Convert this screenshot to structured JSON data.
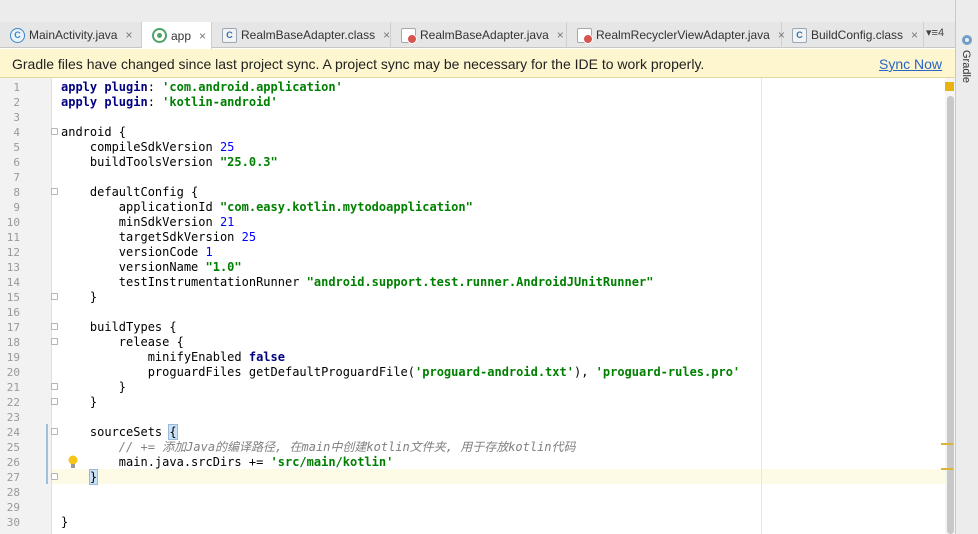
{
  "tabs": [
    {
      "label": "MainActivity.java",
      "icon": "kotlin-class-icon",
      "active": false
    },
    {
      "label": "app",
      "icon": "gradle-module-icon",
      "active": true
    },
    {
      "label": "RealmBaseAdapter.class",
      "icon": "class-file-icon",
      "active": false
    },
    {
      "label": "RealmBaseAdapter.java",
      "icon": "java-file-icon",
      "active": false
    },
    {
      "label": "RealmRecyclerViewAdapter.java",
      "icon": "java-file-icon",
      "active": false
    },
    {
      "label": "BuildConfig.class",
      "icon": "class-file-icon",
      "active": false
    }
  ],
  "tab_close_glyph": "×",
  "tab_overflow": "▾≡4",
  "side_panel": {
    "label": "Gradle"
  },
  "notification": {
    "message": "Gradle files have changed since last project sync. A project sync may be necessary for the IDE to work properly.",
    "action": "Sync Now"
  },
  "editor": {
    "line_numbers": [
      "1",
      "2",
      "3",
      "4",
      "5",
      "6",
      "7",
      "8",
      "9",
      "10",
      "11",
      "12",
      "13",
      "14",
      "15",
      "16",
      "17",
      "18",
      "19",
      "20",
      "21",
      "22",
      "23",
      "24",
      "25",
      "26",
      "27",
      "28",
      "29",
      "30"
    ],
    "lines": [
      [
        {
          "t": "apply plugin",
          "c": "kw"
        },
        {
          "t": ": ",
          "c": ""
        },
        {
          "t": "'com.android.application'",
          "c": "str"
        }
      ],
      [
        {
          "t": "apply plugin",
          "c": "kw"
        },
        {
          "t": ": ",
          "c": ""
        },
        {
          "t": "'kotlin-android'",
          "c": "str"
        }
      ],
      [],
      [
        {
          "t": "android {",
          "c": ""
        }
      ],
      [
        {
          "t": "    compileSdkVersion ",
          "c": ""
        },
        {
          "t": "25",
          "c": "num"
        }
      ],
      [
        {
          "t": "    buildToolsVersion ",
          "c": ""
        },
        {
          "t": "\"25.0.3\"",
          "c": "str"
        }
      ],
      [],
      [
        {
          "t": "    defaultConfig {",
          "c": ""
        }
      ],
      [
        {
          "t": "        applicationId ",
          "c": ""
        },
        {
          "t": "\"com.easy.kotlin.mytodoapplication\"",
          "c": "str"
        }
      ],
      [
        {
          "t": "        minSdkVersion ",
          "c": ""
        },
        {
          "t": "21",
          "c": "num"
        }
      ],
      [
        {
          "t": "        targetSdkVersion ",
          "c": ""
        },
        {
          "t": "25",
          "c": "num"
        }
      ],
      [
        {
          "t": "        versionCode ",
          "c": ""
        },
        {
          "t": "1",
          "c": "num"
        }
      ],
      [
        {
          "t": "        versionName ",
          "c": ""
        },
        {
          "t": "\"1.0\"",
          "c": "str"
        }
      ],
      [
        {
          "t": "        testInstrumentationRunner ",
          "c": ""
        },
        {
          "t": "\"android.support.test.runner.AndroidJUnitRunner\"",
          "c": "str"
        }
      ],
      [
        {
          "t": "    }",
          "c": ""
        }
      ],
      [],
      [
        {
          "t": "    buildTypes {",
          "c": ""
        }
      ],
      [
        {
          "t": "        release {",
          "c": ""
        }
      ],
      [
        {
          "t": "            minifyEnabled ",
          "c": ""
        },
        {
          "t": "false",
          "c": "kw"
        }
      ],
      [
        {
          "t": "            proguardFiles getDefaultProguardFile(",
          "c": ""
        },
        {
          "t": "'proguard-android.txt'",
          "c": "str"
        },
        {
          "t": "), ",
          "c": ""
        },
        {
          "t": "'proguard-rules.pro'",
          "c": "str"
        }
      ],
      [
        {
          "t": "        }",
          "c": ""
        }
      ],
      [
        {
          "t": "    }",
          "c": ""
        }
      ],
      [],
      [
        {
          "t": "    sourceSets ",
          "c": ""
        },
        {
          "t": "{",
          "c": "brace-hl"
        }
      ],
      [
        {
          "t": "        // += 添加Java的编译路径, 在main中创建kotlin文件夹, 用于存放kotlin代码",
          "c": "cmt"
        }
      ],
      [
        {
          "t": "        main.java.srcDirs += ",
          "c": ""
        },
        {
          "t": "'src/main/kotlin'",
          "c": "str"
        }
      ],
      [
        {
          "t": "    ",
          "c": ""
        },
        {
          "t": "}",
          "c": "brace-hl"
        }
      ],
      [],
      [],
      [
        {
          "t": "}",
          "c": ""
        }
      ]
    ]
  },
  "colors": {
    "keyword": "#000080",
    "string": "#008000",
    "number": "#0000ff",
    "comment": "#808080",
    "notification_bg": "#fdf6cf",
    "link": "#2a64c5"
  }
}
